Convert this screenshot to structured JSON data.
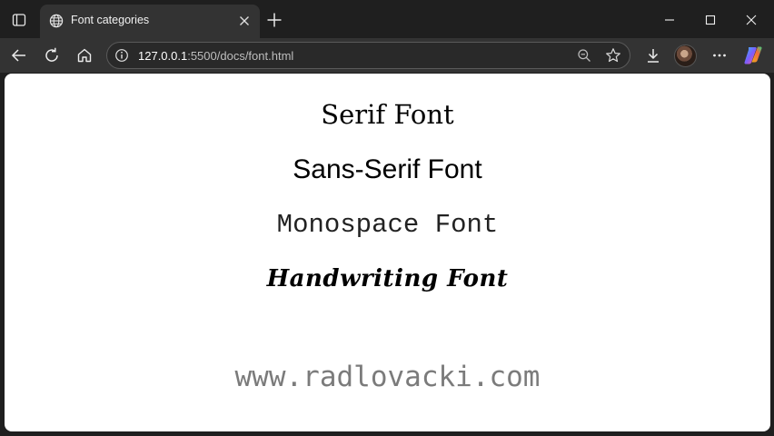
{
  "browser": {
    "tab": {
      "title": "Font categories",
      "favicon": "globe-icon"
    },
    "address": {
      "host": "127.0.0.1",
      "path": ":5500/docs/font.html"
    },
    "toolbar_icons": [
      "back-arrow-icon",
      "reload-icon",
      "home-icon",
      "info-icon",
      "zoom-out-icon",
      "star-icon",
      "download-icon",
      "more-icon",
      "copilot-icon"
    ]
  },
  "page": {
    "lines": {
      "serif": "Serif Font",
      "sans": "Sans-Serif Font",
      "mono": "Monospace Font",
      "handwriting": "Handwriting Font"
    },
    "website": "www.radlovacki.com"
  },
  "colors": {
    "chrome_dark": "#1f1f1f",
    "toolbar": "#333333",
    "page_bg": "#ffffff",
    "watermark": "#7b7b7b"
  }
}
